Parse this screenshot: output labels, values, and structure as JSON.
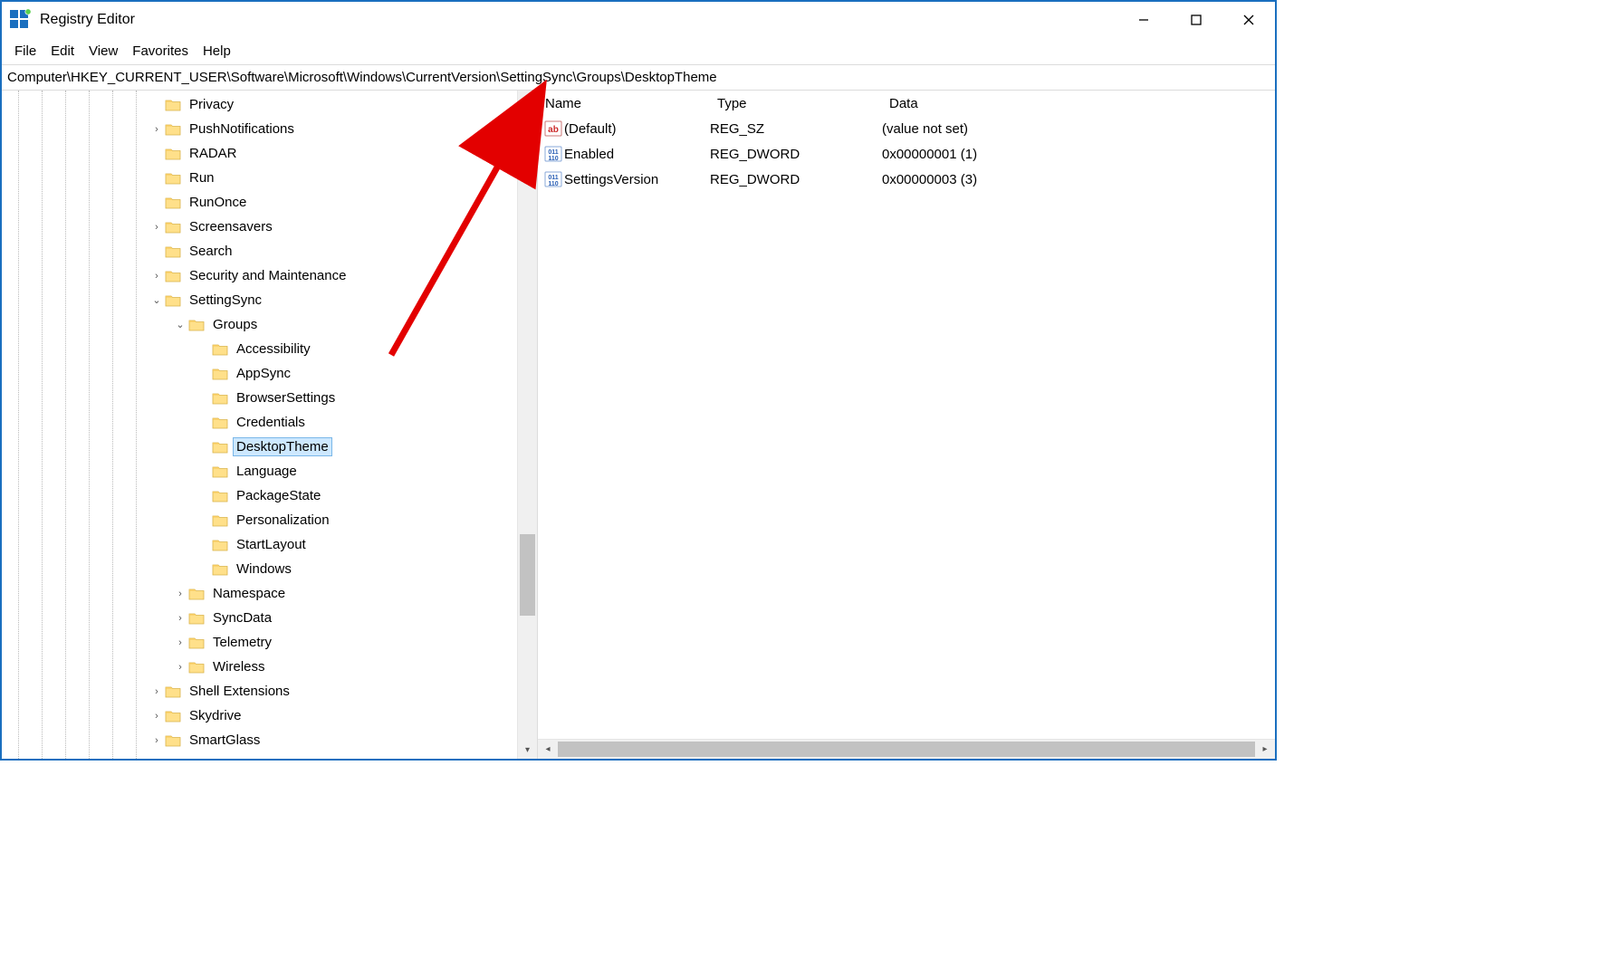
{
  "window": {
    "title": "Registry Editor"
  },
  "menu": {
    "items": [
      "File",
      "Edit",
      "View",
      "Favorites",
      "Help"
    ]
  },
  "address": "Computer\\HKEY_CURRENT_USER\\Software\\Microsoft\\Windows\\CurrentVersion\\SettingSync\\Groups\\DesktopTheme",
  "tree": [
    {
      "depth": 0,
      "label": "Privacy",
      "expander": ""
    },
    {
      "depth": 0,
      "label": "PushNotifications",
      "expander": ">"
    },
    {
      "depth": 0,
      "label": "RADAR",
      "expander": ""
    },
    {
      "depth": 0,
      "label": "Run",
      "expander": ""
    },
    {
      "depth": 0,
      "label": "RunOnce",
      "expander": ""
    },
    {
      "depth": 0,
      "label": "Screensavers",
      "expander": ">"
    },
    {
      "depth": 0,
      "label": "Search",
      "expander": ""
    },
    {
      "depth": 0,
      "label": "Security and Maintenance",
      "expander": ">"
    },
    {
      "depth": 0,
      "label": "SettingSync",
      "expander": "v"
    },
    {
      "depth": 1,
      "label": "Groups",
      "expander": "v"
    },
    {
      "depth": 2,
      "label": "Accessibility",
      "expander": ""
    },
    {
      "depth": 2,
      "label": "AppSync",
      "expander": ""
    },
    {
      "depth": 2,
      "label": "BrowserSettings",
      "expander": ""
    },
    {
      "depth": 2,
      "label": "Credentials",
      "expander": ""
    },
    {
      "depth": 2,
      "label": "DesktopTheme",
      "expander": "",
      "selected": true
    },
    {
      "depth": 2,
      "label": "Language",
      "expander": ""
    },
    {
      "depth": 2,
      "label": "PackageState",
      "expander": ""
    },
    {
      "depth": 2,
      "label": "Personalization",
      "expander": ""
    },
    {
      "depth": 2,
      "label": "StartLayout",
      "expander": ""
    },
    {
      "depth": 2,
      "label": "Windows",
      "expander": ""
    },
    {
      "depth": 1,
      "label": "Namespace",
      "expander": ">"
    },
    {
      "depth": 1,
      "label": "SyncData",
      "expander": ">"
    },
    {
      "depth": 1,
      "label": "Telemetry",
      "expander": ">"
    },
    {
      "depth": 1,
      "label": "Wireless",
      "expander": ">"
    },
    {
      "depth": 0,
      "label": "Shell Extensions",
      "expander": ">"
    },
    {
      "depth": 0,
      "label": "Skydrive",
      "expander": ">"
    },
    {
      "depth": 0,
      "label": "SmartGlass",
      "expander": ">"
    }
  ],
  "list": {
    "columns": {
      "name": "Name",
      "type": "Type",
      "data": "Data"
    },
    "rows": [
      {
        "icon": "string",
        "name": "(Default)",
        "type": "REG_SZ",
        "data": "(value not set)"
      },
      {
        "icon": "binary",
        "name": "Enabled",
        "type": "REG_DWORD",
        "data": "0x00000001 (1)"
      },
      {
        "icon": "binary",
        "name": "SettingsVersion",
        "type": "REG_DWORD",
        "data": "0x00000003 (3)"
      }
    ]
  }
}
